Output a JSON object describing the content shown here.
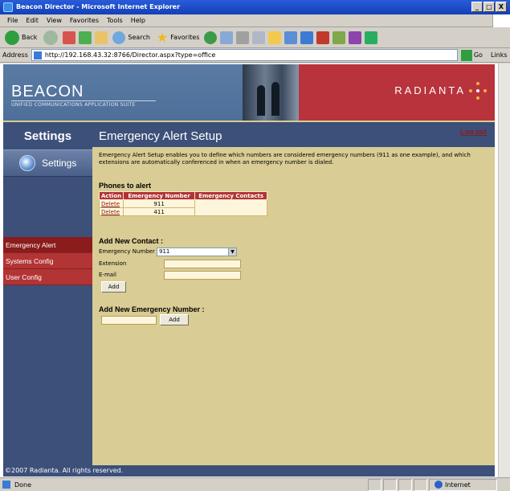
{
  "window": {
    "title": "Beacon Director - Microsoft Internet Explorer",
    "controls": [
      "_",
      "□",
      "X"
    ]
  },
  "menu": [
    "File",
    "Edit",
    "View",
    "Favorites",
    "Tools",
    "Help"
  ],
  "toolbar": {
    "back_label": "Back",
    "search_label": "Search",
    "favorites_label": "Favorites"
  },
  "address": {
    "label": "Address",
    "url": "http://192.168.43.32:8766/Director.aspx?type=office",
    "go_label": "Go",
    "links_label": "Links"
  },
  "banner": {
    "brand": "BEACON",
    "tagline": "UNIFIED COMMUNICATIONS APPLICATION SUITE",
    "partner": "RADIANTA"
  },
  "sidebar": {
    "title": "Settings",
    "panel_label": "Settings",
    "items": [
      {
        "label": "Emergency Alert",
        "active": true
      },
      {
        "label": "Systems Config",
        "active": false
      },
      {
        "label": "User Config",
        "active": false
      }
    ]
  },
  "content": {
    "title": "Emergency Alert Setup",
    "logout": "Log out",
    "description": "Emergency Alert Setup enables you to define which numbers are considered emergency numbers (911 as one example), and which extensions are automatically conferenced in when an emergency number is dialed."
  },
  "phones": {
    "title": "Phones to alert",
    "columns": [
      "Action",
      "Emergency Number",
      "Emergency Contacts"
    ],
    "rows": [
      {
        "action": "Delete",
        "number": "911",
        "contacts": ""
      },
      {
        "action": "Delete",
        "number": "411",
        "contacts": ""
      }
    ]
  },
  "add_contact": {
    "title": "Add New Contact :",
    "number_label": "Emergency Number",
    "number_value": "911",
    "extension_label": "Extension",
    "email_label": "E-mail",
    "add_button": "Add"
  },
  "add_number": {
    "title": "Add New Emergency Number :",
    "add_button": "Add"
  },
  "footer": {
    "copyright": "©2007 Radianta. All rights reserved."
  },
  "status": {
    "text": "Done",
    "zone": "Internet"
  }
}
